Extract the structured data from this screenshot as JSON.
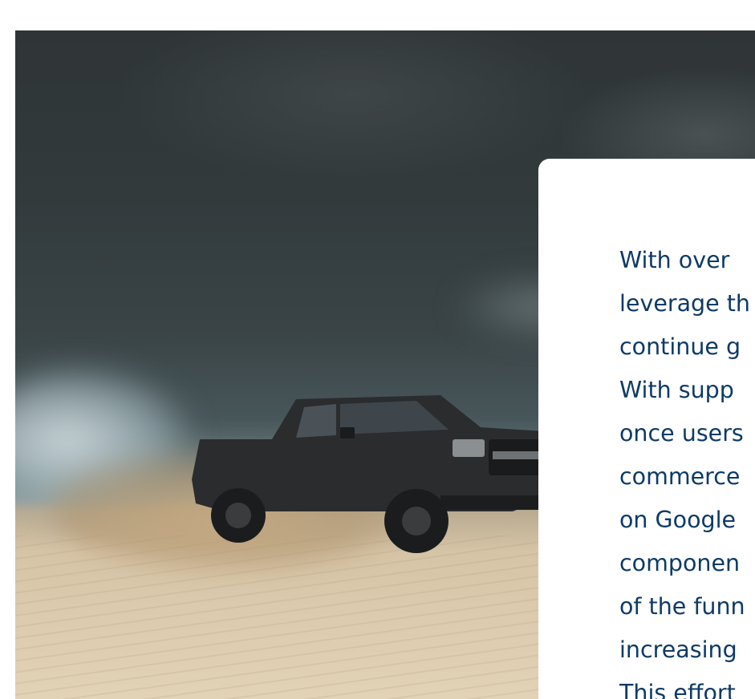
{
  "hero": {
    "icon": "pickup-truck-photo"
  },
  "card": {
    "lines": [
      "With over",
      "leverage th",
      "continue g",
      "With supp",
      "once users",
      "commerce",
      "on Google",
      "componen",
      "of the funn",
      "increasing",
      "This effort"
    ]
  },
  "colors": {
    "page_background": "#ffffff",
    "card_background": "#ffffff",
    "body_text": "#0e3a66"
  }
}
